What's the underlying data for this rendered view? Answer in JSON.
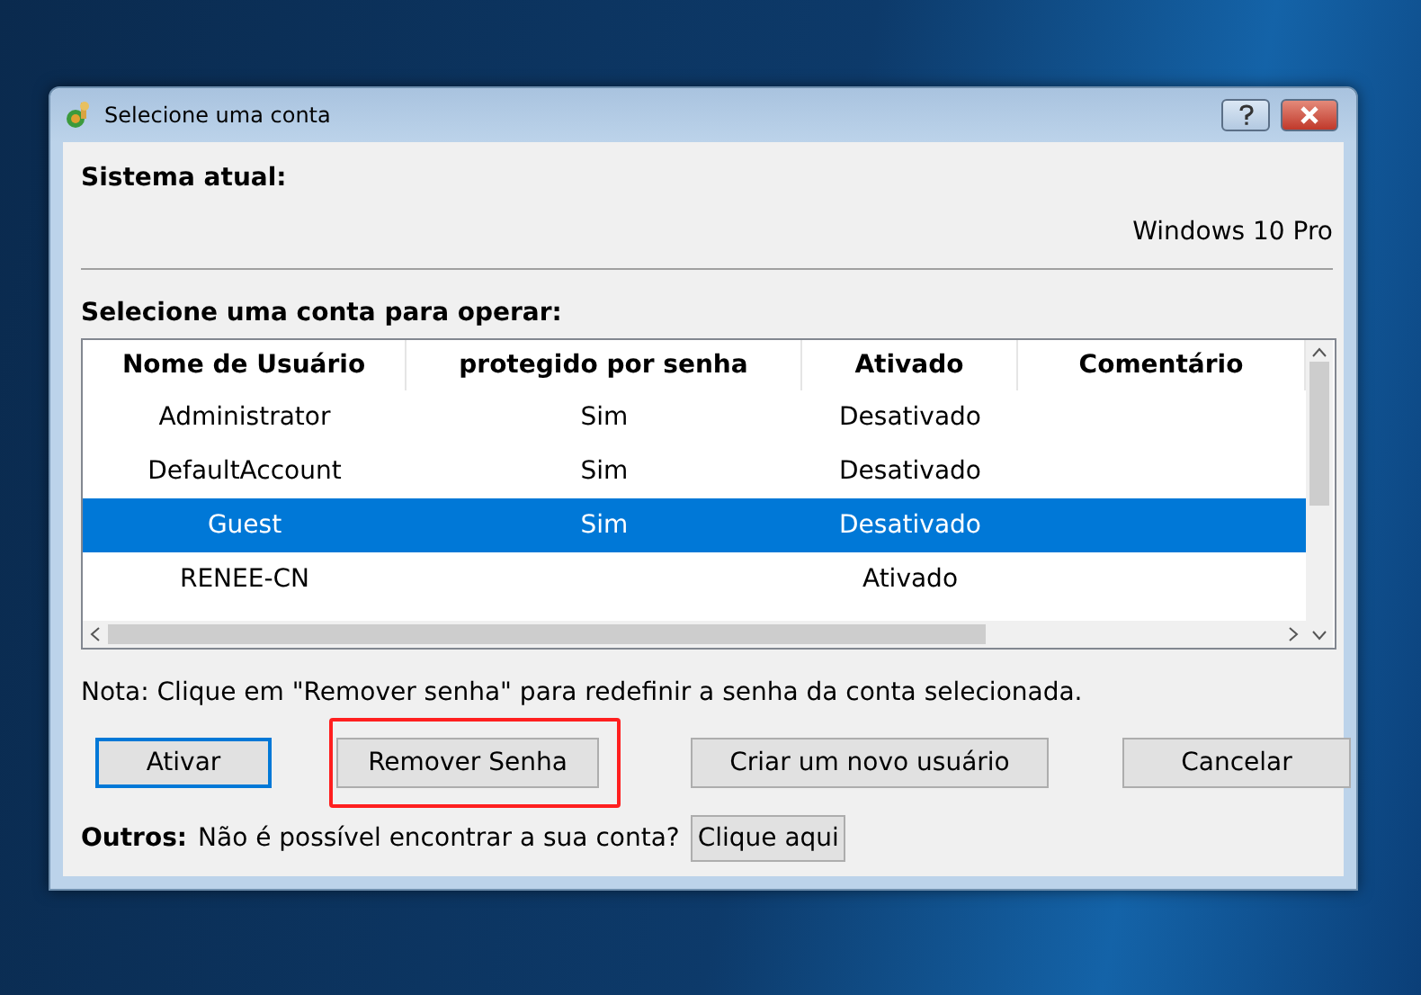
{
  "window": {
    "title": "Selecione uma conta"
  },
  "system": {
    "label": "Sistema atual:",
    "value": "Windows 10 Pro"
  },
  "accounts": {
    "label": "Selecione uma conta para operar:",
    "columns": [
      "Nome de Usuário",
      "protegido por senha",
      "Ativado",
      "Comentário"
    ],
    "rows": [
      {
        "name": "Administrator",
        "protected": "Sim",
        "enabled": "Desativado",
        "selected": false
      },
      {
        "name": "DefaultAccount",
        "protected": "Sim",
        "enabled": "Desativado",
        "selected": false
      },
      {
        "name": "Guest",
        "protected": "Sim",
        "enabled": "Desativado",
        "selected": true
      },
      {
        "name": "RENEE-CN",
        "enabled": "Ativado",
        "selected": false
      }
    ]
  },
  "note": "Nota: Clique em \"Remover senha\" para redefinir a senha da conta selecionada.",
  "buttons": [
    {
      "label": "Ativar",
      "default": true,
      "highlighted": false
    },
    {
      "label": "Remover Senha",
      "default": false,
      "highlighted": true
    },
    {
      "label": "Criar um novo usuário",
      "default": false,
      "highlighted": false
    },
    {
      "label": "Cancelar",
      "default": false,
      "highlighted": false
    }
  ],
  "others": {
    "label": "Outros:",
    "text": "Não é possível encontrar a sua conta?",
    "link": "Clique aqui"
  }
}
